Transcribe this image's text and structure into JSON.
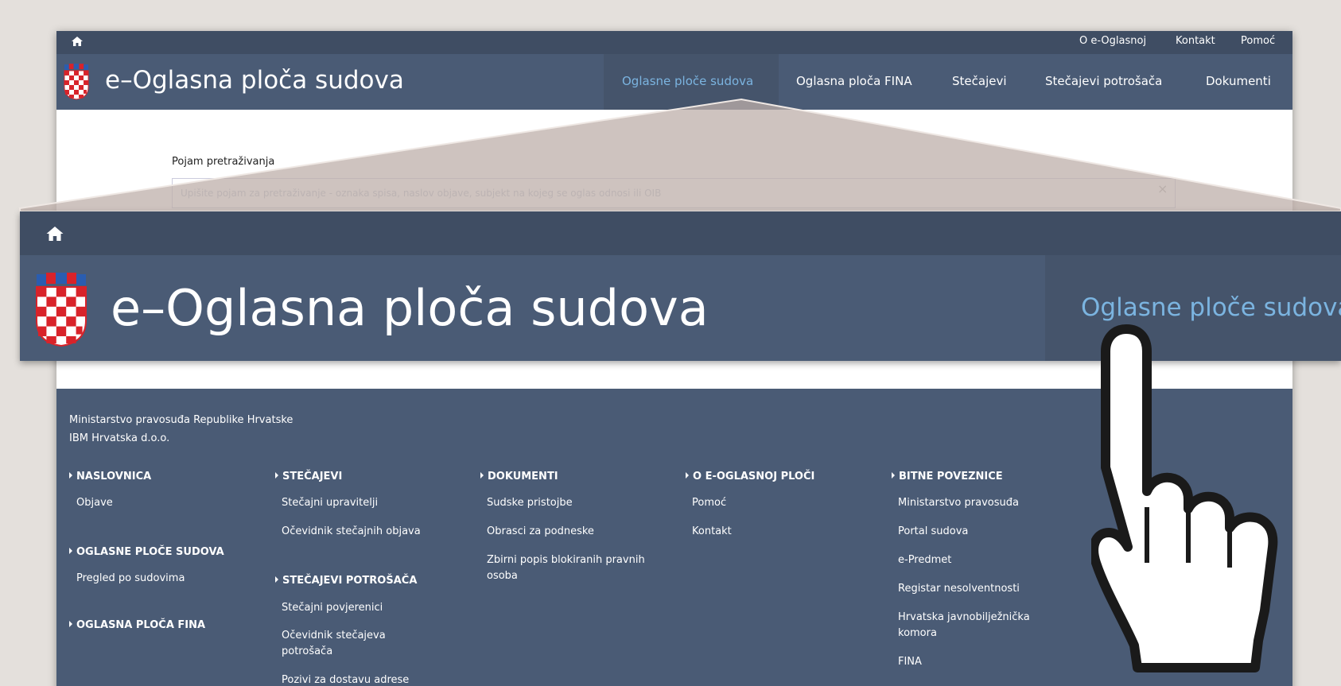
{
  "topbar": {
    "links": [
      "O e-Oglasnoj",
      "Kontakt",
      "Pomoć"
    ]
  },
  "brand": {
    "title": "e–Oglasna ploča sudova"
  },
  "nav": {
    "items": [
      "Oglasne ploče sudova",
      "Oglasna ploča FINA",
      "Stečajevi",
      "Stečajevi potrošača",
      "Dokumenti"
    ],
    "active": "Oglasne ploče sudova"
  },
  "search": {
    "label": "Pojam pretraživanja",
    "placeholder": "Upišite pojam za pretraživanje - oznaka spisa, naslov objave, subjekt na kojeg se oglas odnosi ili OIB",
    "clear": "×"
  },
  "footer": {
    "org_lines": [
      "Ministarstvo pravosuđa Republike Hrvatske",
      "IBM Hrvatska d.o.o."
    ],
    "col1": {
      "head1": "NASLOVNICA",
      "links1": [
        "Objave"
      ],
      "head2": "OGLASNE PLOČE SUDOVA",
      "links2": [
        "Pregled po sudovima"
      ],
      "head3": "OGLASNA PLOČA FINA"
    },
    "col2": {
      "head1": "STEČAJEVI",
      "links1": [
        "Stečajni upravitelji",
        "Očevidnik stečajnih objava"
      ],
      "head2": "STEČAJEVI POTROŠAČA",
      "links2": [
        "Stečajni povjerenici",
        "Očevidnik stečajeva potrošača",
        "Pozivi za dostavu adrese"
      ]
    },
    "col3": {
      "head1": "DOKUMENTI",
      "links1": [
        "Sudske pristojbe",
        "Obrasci za podneske",
        "Zbirni popis blokiranih pravnih osoba"
      ]
    },
    "col4": {
      "head1": "O E-OGLASNOJ PLOČI",
      "links1": [
        "Pomoć",
        "Kontakt"
      ]
    },
    "col5": {
      "head1": "BITNE POVEZNICE",
      "links1": [
        "Ministarstvo pravosuđa",
        "Portal sudova",
        "e-Predmet",
        "Registar nesolventnosti",
        "Hrvatska javnobilježnička komora",
        "FINA"
      ]
    }
  },
  "zoom": {
    "title": "e–Oglasna ploča sudova",
    "link": "Oglasne ploče sudova"
  },
  "icons": {
    "home": "home-icon",
    "logo": "croatian-coat-of-arms-icon",
    "cursor": "pointing-hand-cursor-icon"
  },
  "colors": {
    "navbar": "#4a5b75",
    "topstrip": "#3f4d63",
    "active_link": "#7bb4e0",
    "background": "#e4e0dc"
  }
}
